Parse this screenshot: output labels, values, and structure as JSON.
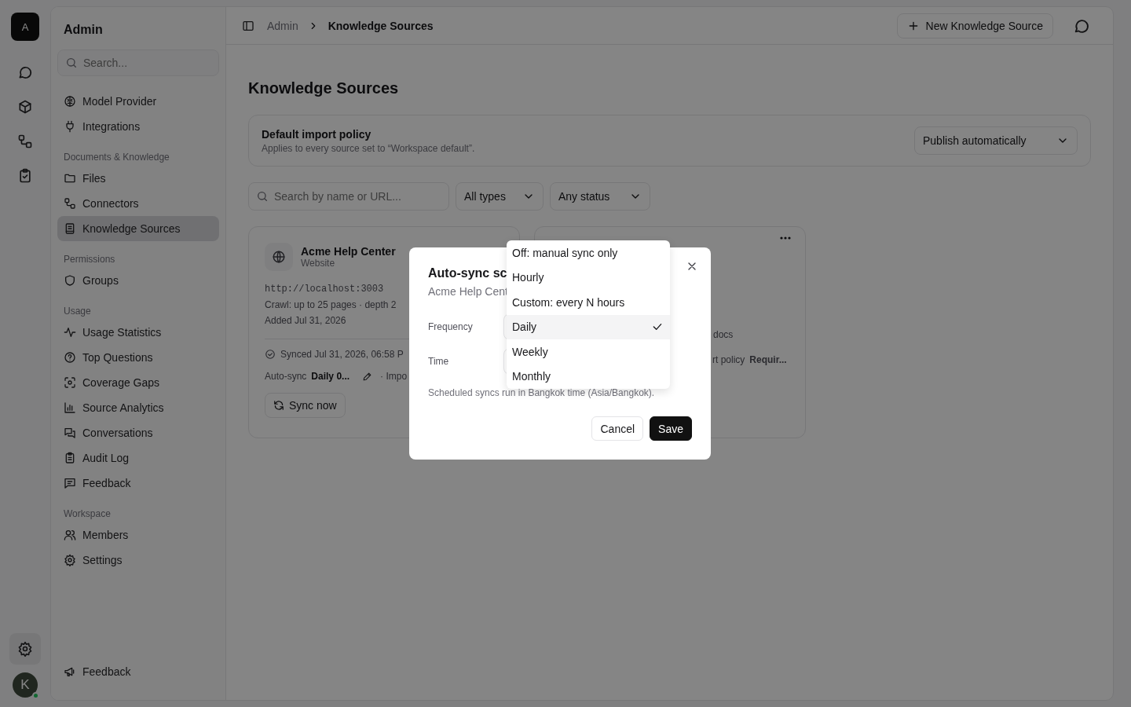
{
  "rail": {
    "logo": "A",
    "avatar": "K"
  },
  "sidebar": {
    "title": "Admin",
    "search_placeholder": "Search...",
    "sections": [
      {
        "items": [
          {
            "label": "Model Provider",
            "selected": false
          },
          {
            "label": "Integrations",
            "selected": false
          }
        ]
      },
      {
        "heading": "Documents & Knowledge",
        "items": [
          {
            "label": "Files",
            "selected": false
          },
          {
            "label": "Connectors",
            "selected": false
          },
          {
            "label": "Knowledge Sources",
            "selected": true
          }
        ]
      },
      {
        "heading": "Permissions",
        "items": [
          {
            "label": "Groups",
            "selected": false
          }
        ]
      },
      {
        "heading": "Usage",
        "items": [
          {
            "label": "Usage Statistics",
            "selected": false
          },
          {
            "label": "Top Questions",
            "selected": false
          },
          {
            "label": "Coverage Gaps",
            "selected": false
          },
          {
            "label": "Source Analytics",
            "selected": false
          },
          {
            "label": "Conversations",
            "selected": false
          },
          {
            "label": "Audit Log",
            "selected": false
          },
          {
            "label": "Feedback",
            "selected": false
          }
        ]
      },
      {
        "heading": "Workspace",
        "items": [
          {
            "label": "Members",
            "selected": false
          },
          {
            "label": "Settings",
            "selected": false
          }
        ]
      }
    ],
    "footer_item": "Feedback"
  },
  "breadcrumb": [
    "Admin",
    "Knowledge Sources"
  ],
  "new_button": "New Knowledge Source",
  "page_title": "Knowledge Sources",
  "policy": {
    "title": "Default import policy",
    "description": "Applies to every source set to “Workspace default”.",
    "value": "Publish automatically"
  },
  "filters": {
    "search_placeholder": "Search by name or URL...",
    "type": "All types",
    "status": "Any status"
  },
  "cards": [
    {
      "kind": "full",
      "name": "Acme Help Center",
      "type": "Website",
      "url": "http://localhost:3003",
      "crawl": "Crawl: up to 25 pages · depth 2",
      "added": "Added Jul 31, 2026",
      "synced": "Synced Jul 31, 2026, 06:58 P",
      "autosync_label": "Auto-sync",
      "autosync_value": "Daily 0...",
      "import_fragment": "· Impo",
      "sync_button": "Sync now"
    },
    {
      "kind": "covered",
      "docs_fragment": "docs",
      "policy_label": "rt policy",
      "policy_value": "Requir..."
    }
  ],
  "modal": {
    "title": "Auto-sync sc",
    "subtitle": "Acme Help Cent",
    "fields": [
      {
        "label": "Frequency"
      },
      {
        "label": "Time"
      }
    ],
    "note": "Scheduled syncs run in Bangkok time (Asia/Bangkok).",
    "buttons": [
      {
        "label": "Cancel",
        "kind": "secondary"
      },
      {
        "label": "Save",
        "kind": "primary"
      }
    ]
  },
  "dropdown": {
    "options": [
      {
        "label": "Off: manual sync only",
        "selected": false
      },
      {
        "label": "Hourly",
        "selected": false
      },
      {
        "label": "Custom: every N hours",
        "selected": false
      },
      {
        "label": "Daily",
        "selected": true
      },
      {
        "label": "Weekly",
        "selected": false
      },
      {
        "label": "Monthly",
        "selected": false
      }
    ]
  }
}
